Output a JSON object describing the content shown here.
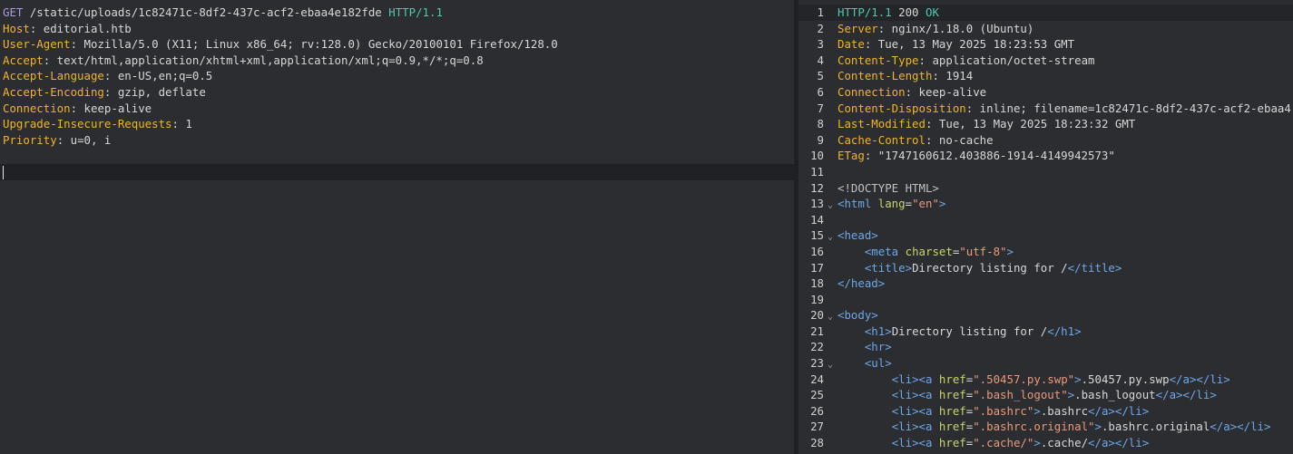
{
  "request": {
    "method": "GET",
    "path": " /static/uploads/1c82471c-8df2-437c-acf2-ebaa4e182fde ",
    "version": "HTTP/1.1",
    "headers": [
      {
        "key": "Host",
        "value": ": editorial.htb"
      },
      {
        "key": "User-Agent",
        "value": ": Mozilla/5.0 (X11; Linux x86_64; rv:128.0) Gecko/20100101 Firefox/128.0"
      },
      {
        "key": "Accept",
        "value": ": text/html,application/xhtml+xml,application/xml;q=0.9,*/*;q=0.8"
      },
      {
        "key": "Accept-Language",
        "value": ": en-US,en;q=0.5"
      },
      {
        "key": "Accept-Encoding",
        "value": ": gzip, deflate"
      },
      {
        "key": "Connection",
        "value": ": keep-alive"
      },
      {
        "key": "Upgrade-Insecure-Requests",
        "value": ": 1"
      },
      {
        "key": "Priority",
        "value": ": u=0, i"
      }
    ]
  },
  "response": {
    "lines": [
      {
        "n": "1",
        "parts": [
          {
            "c": "ver",
            "t": "HTTP/1.1 "
          },
          {
            "c": "plain",
            "t": "200 "
          },
          {
            "c": "ver",
            "t": "OK"
          }
        ]
      },
      {
        "n": "2",
        "parts": [
          {
            "c": "hk",
            "t": "Server"
          },
          {
            "c": "plain",
            "t": ": nginx/1.18.0 (Ubuntu)"
          }
        ]
      },
      {
        "n": "3",
        "parts": [
          {
            "c": "hk",
            "t": "Date"
          },
          {
            "c": "plain",
            "t": ": Tue, 13 May 2025 18:23:53 GMT"
          }
        ]
      },
      {
        "n": "4",
        "parts": [
          {
            "c": "hk",
            "t": "Content-Type"
          },
          {
            "c": "plain",
            "t": ": application/octet-stream"
          }
        ]
      },
      {
        "n": "5",
        "parts": [
          {
            "c": "hk",
            "t": "Content-Length"
          },
          {
            "c": "plain",
            "t": ": 1914"
          }
        ]
      },
      {
        "n": "6",
        "parts": [
          {
            "c": "hk",
            "t": "Connection"
          },
          {
            "c": "plain",
            "t": ": keep-alive"
          }
        ]
      },
      {
        "n": "7",
        "parts": [
          {
            "c": "hk",
            "t": "Content-Disposition"
          },
          {
            "c": "plain",
            "t": ": inline; filename=1c82471c-8df2-437c-acf2-ebaa4"
          }
        ]
      },
      {
        "n": "8",
        "parts": [
          {
            "c": "hk",
            "t": "Last-Modified"
          },
          {
            "c": "plain",
            "t": ": Tue, 13 May 2025 18:23:32 GMT"
          }
        ]
      },
      {
        "n": "9",
        "parts": [
          {
            "c": "hk",
            "t": "Cache-Control"
          },
          {
            "c": "plain",
            "t": ": no-cache"
          }
        ]
      },
      {
        "n": "10",
        "parts": [
          {
            "c": "hk",
            "t": "ETag"
          },
          {
            "c": "plain",
            "t": ": \"1747160612.403886-1914-4149942573\""
          }
        ]
      },
      {
        "n": "11",
        "parts": []
      },
      {
        "n": "12",
        "parts": [
          {
            "c": "cmt",
            "t": "<!DOCTYPE HTML>"
          }
        ]
      },
      {
        "n": "13",
        "fold": true,
        "parts": [
          {
            "c": "tag",
            "t": "<html "
          },
          {
            "c": "attr",
            "t": "lang"
          },
          {
            "c": "plain",
            "t": "="
          },
          {
            "c": "str",
            "t": "\"en\""
          },
          {
            "c": "tag",
            "t": ">"
          }
        ]
      },
      {
        "n": "14",
        "parts": []
      },
      {
        "n": "15",
        "fold": true,
        "parts": [
          {
            "c": "tag",
            "t": "<head>"
          }
        ]
      },
      {
        "n": "16",
        "parts": [
          {
            "c": "plain",
            "t": "    "
          },
          {
            "c": "tag",
            "t": "<meta "
          },
          {
            "c": "attr",
            "t": "charset"
          },
          {
            "c": "plain",
            "t": "="
          },
          {
            "c": "str",
            "t": "\"utf-8\""
          },
          {
            "c": "tag",
            "t": ">"
          }
        ]
      },
      {
        "n": "17",
        "parts": [
          {
            "c": "plain",
            "t": "    "
          },
          {
            "c": "tag",
            "t": "<title>"
          },
          {
            "c": "plain",
            "t": "Directory listing for /"
          },
          {
            "c": "tag",
            "t": "</title>"
          }
        ]
      },
      {
        "n": "18",
        "parts": [
          {
            "c": "tag",
            "t": "</head>"
          }
        ]
      },
      {
        "n": "19",
        "parts": []
      },
      {
        "n": "20",
        "fold": true,
        "parts": [
          {
            "c": "tag",
            "t": "<body>"
          }
        ]
      },
      {
        "n": "21",
        "parts": [
          {
            "c": "plain",
            "t": "    "
          },
          {
            "c": "tag",
            "t": "<h1>"
          },
          {
            "c": "plain",
            "t": "Directory listing for /"
          },
          {
            "c": "tag",
            "t": "</h1>"
          }
        ]
      },
      {
        "n": "22",
        "parts": [
          {
            "c": "plain",
            "t": "    "
          },
          {
            "c": "tag",
            "t": "<hr>"
          }
        ]
      },
      {
        "n": "23",
        "fold": true,
        "parts": [
          {
            "c": "plain",
            "t": "    "
          },
          {
            "c": "tag",
            "t": "<ul>"
          }
        ]
      },
      {
        "n": "24",
        "parts": [
          {
            "c": "plain",
            "t": "        "
          },
          {
            "c": "tag",
            "t": "<li><a "
          },
          {
            "c": "attr",
            "t": "href"
          },
          {
            "c": "plain",
            "t": "="
          },
          {
            "c": "str",
            "t": "\".50457.py.swp\""
          },
          {
            "c": "tag",
            "t": ">"
          },
          {
            "c": "plain",
            "t": ".50457.py.swp"
          },
          {
            "c": "tag",
            "t": "</a></li>"
          }
        ]
      },
      {
        "n": "25",
        "parts": [
          {
            "c": "plain",
            "t": "        "
          },
          {
            "c": "tag",
            "t": "<li><a "
          },
          {
            "c": "attr",
            "t": "href"
          },
          {
            "c": "plain",
            "t": "="
          },
          {
            "c": "str",
            "t": "\".bash_logout\""
          },
          {
            "c": "tag",
            "t": ">"
          },
          {
            "c": "plain",
            "t": ".bash_logout"
          },
          {
            "c": "tag",
            "t": "</a></li>"
          }
        ]
      },
      {
        "n": "26",
        "parts": [
          {
            "c": "plain",
            "t": "        "
          },
          {
            "c": "tag",
            "t": "<li><a "
          },
          {
            "c": "attr",
            "t": "href"
          },
          {
            "c": "plain",
            "t": "="
          },
          {
            "c": "str",
            "t": "\".bashrc\""
          },
          {
            "c": "tag",
            "t": ">"
          },
          {
            "c": "plain",
            "t": ".bashrc"
          },
          {
            "c": "tag",
            "t": "</a></li>"
          }
        ]
      },
      {
        "n": "27",
        "parts": [
          {
            "c": "plain",
            "t": "        "
          },
          {
            "c": "tag",
            "t": "<li><a "
          },
          {
            "c": "attr",
            "t": "href"
          },
          {
            "c": "plain",
            "t": "="
          },
          {
            "c": "str",
            "t": "\".bashrc.original\""
          },
          {
            "c": "tag",
            "t": ">"
          },
          {
            "c": "plain",
            "t": ".bashrc.original"
          },
          {
            "c": "tag",
            "t": "</a></li>"
          }
        ]
      },
      {
        "n": "28",
        "parts": [
          {
            "c": "plain",
            "t": "        "
          },
          {
            "c": "tag",
            "t": "<li><a "
          },
          {
            "c": "attr",
            "t": "href"
          },
          {
            "c": "plain",
            "t": "="
          },
          {
            "c": "str",
            "t": "\".cache/\""
          },
          {
            "c": "tag",
            "t": ">"
          },
          {
            "c": "plain",
            "t": ".cache/"
          },
          {
            "c": "tag",
            "t": "</a></li>"
          }
        ]
      }
    ]
  }
}
